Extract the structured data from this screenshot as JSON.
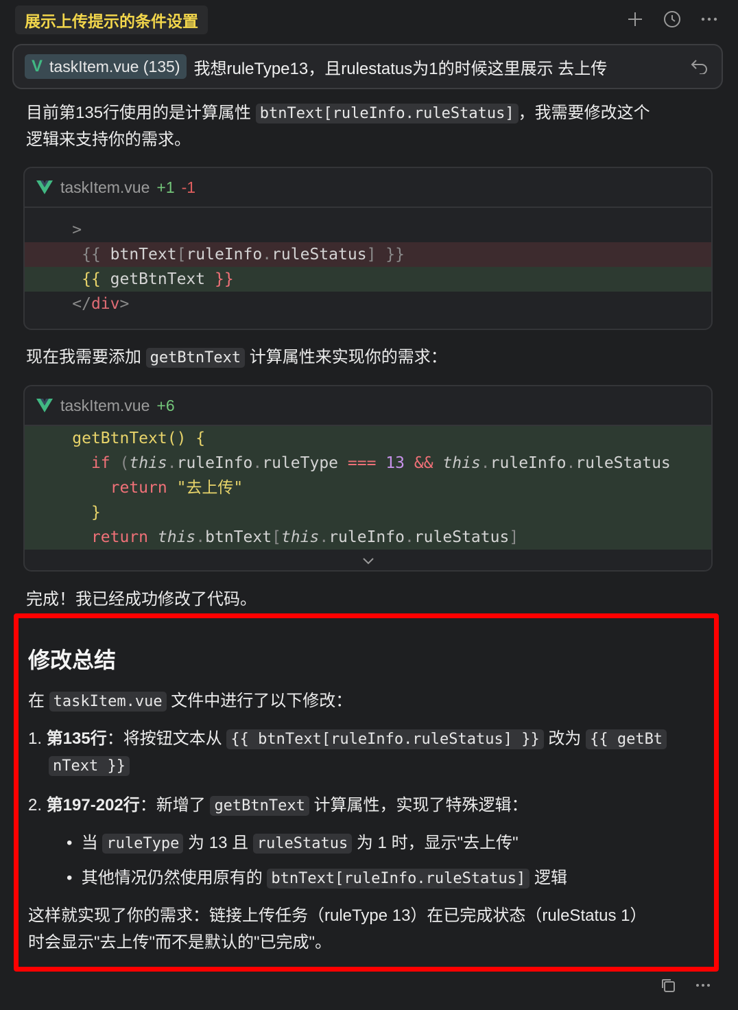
{
  "header": {
    "title": "展示上传提示的条件设置"
  },
  "prompt": {
    "file_ref": "taskItem.vue (135)",
    "text": "我想ruleType13，且rulestatus为1的时候这里展示 去上传"
  },
  "para1": {
    "before": "目前第135行使用的是计算属性 ",
    "code": "btnText[ruleInfo.ruleStatus]",
    "after_line1": "，我需要修改这个",
    "line2": "逻辑来支持你的需求。"
  },
  "block1": {
    "filename": "taskItem.vue",
    "added": "+1",
    "removed": "-1"
  },
  "para2": {
    "before": "现在我需要添加 ",
    "code": "getBtnText",
    "after": " 计算属性来实现你的需求："
  },
  "block2": {
    "filename": "taskItem.vue",
    "added": "+6",
    "return_str": "\"去上传\""
  },
  "para3": "完成！我已经成功修改了代码。",
  "summary": {
    "title": "修改总结",
    "intro_before": "在 ",
    "intro_code": "taskItem.vue",
    "intro_after": " 文件中进行了以下修改：",
    "item1_num": "1. ",
    "item1_bold": "第135行",
    "item1_text": "：将按钮文本从 ",
    "item1_code_from": "{{ btnText[ruleInfo.ruleStatus] }}",
    "item1_mid": " 改为 ",
    "item1_code_to_a": "{{ getBt",
    "item1_code_to_b": "nText }}",
    "item2_num": "2. ",
    "item2_bold": "第197-202行",
    "item2_text": "：新增了 ",
    "item2_code": "getBtnText",
    "item2_after": " 计算属性，实现了特殊逻辑：",
    "bullet1_a": "当 ",
    "bullet1_code1": "ruleType",
    "bullet1_b": " 为 13 且 ",
    "bullet1_code2": "ruleStatus",
    "bullet1_c": " 为 1 时，显示\"去上传\"",
    "bullet2_a": "其他情况仍然使用原有的 ",
    "bullet2_code": "btnText[ruleInfo.ruleStatus]",
    "bullet2_b": " 逻辑",
    "conclusion_line1": "这样就实现了你的需求：链接上传任务（ruleType 13）在已完成状态（ruleStatus 1）",
    "conclusion_line2": "时会显示\"去上传\"而不是默认的\"已完成\"。"
  }
}
